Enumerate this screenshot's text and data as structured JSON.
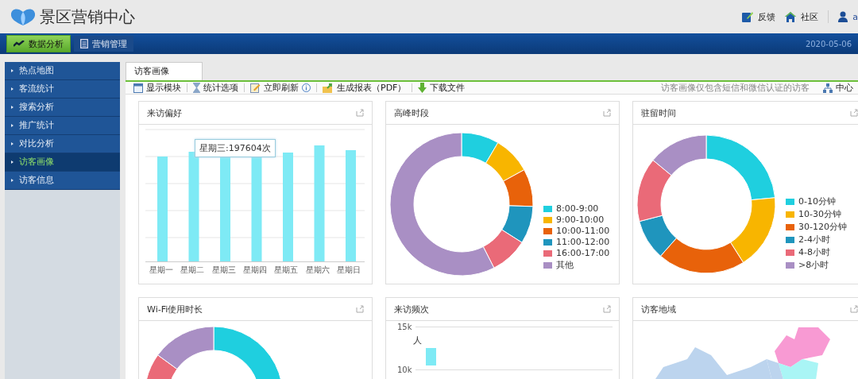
{
  "header": {
    "title": "景区营销中心",
    "links": [
      {
        "kind": "feedback",
        "label": "反馈"
      },
      {
        "kind": "community",
        "label": "社区"
      },
      {
        "kind": "user",
        "label": "a"
      }
    ]
  },
  "nav": {
    "tabs": [
      {
        "label": "数据分析",
        "selected": true
      },
      {
        "label": "营销管理",
        "selected": false
      }
    ],
    "date": "2020-05-06"
  },
  "sidebar": {
    "items": [
      {
        "label": "热点地图",
        "selected": false
      },
      {
        "label": "客流统计",
        "selected": false
      },
      {
        "label": "搜索分析",
        "selected": false
      },
      {
        "label": "推广统计",
        "selected": false
      },
      {
        "label": "对比分析",
        "selected": false
      },
      {
        "label": "访客画像",
        "selected": true
      },
      {
        "label": "访客信息",
        "selected": false
      }
    ]
  },
  "page_tabs": [
    {
      "label": "访客画像",
      "selected": true
    }
  ],
  "toolbar": {
    "buttons": [
      {
        "label": "显示模块",
        "info": false
      },
      {
        "label": "统计选项",
        "info": false
      },
      {
        "label": "立即刷新",
        "info": true
      },
      {
        "label": "生成报表（PDF）",
        "info": false
      },
      {
        "label": "下载文件",
        "info": false
      }
    ],
    "note": "访客画像仅包含短信和微信认证的访客",
    "right_link": "中心"
  },
  "cards": [
    {
      "kind": "bars",
      "title": "来访偏好",
      "categories": [
        "星期一",
        "星期二",
        "星期三",
        "星期四",
        "星期五",
        "星期六",
        "星期日"
      ],
      "tooltip": "星期三:197604次"
    },
    {
      "kind": "donut",
      "title": "高峰时段",
      "legend": [
        {
          "label": "8:00-9:00",
          "color": "#1fcfdf"
        },
        {
          "label": "9:00-10:00",
          "color": "#f8b500"
        },
        {
          "label": "10:00-11:00",
          "color": "#e8620a"
        },
        {
          "label": "11:00-12:00",
          "color": "#1f95bd"
        },
        {
          "label": "16:00-17:00",
          "color": "#ea6a78"
        },
        {
          "label": "其他",
          "color": "#a98fc4"
        }
      ]
    },
    {
      "kind": "donut",
      "title": "驻留时间",
      "legend": [
        {
          "label": "0-10分钟",
          "color": "#1fcfdf"
        },
        {
          "label": "10-30分钟",
          "color": "#f8b500"
        },
        {
          "label": "30-120分钟",
          "color": "#e8620a"
        },
        {
          "label": "2-4小时",
          "color": "#1f95bd"
        },
        {
          "label": "4-8小时",
          "color": "#ea6a78"
        },
        {
          "label": ">8小时",
          "color": "#a98fc4"
        }
      ]
    },
    {
      "kind": "wifi",
      "title": "Wi-Fi使用时长"
    },
    {
      "kind": "freq",
      "title": "来访频次",
      "ticks": [
        "15k",
        "10k"
      ],
      "unit": "人"
    },
    {
      "kind": "map",
      "title": "访客地域"
    }
  ]
}
